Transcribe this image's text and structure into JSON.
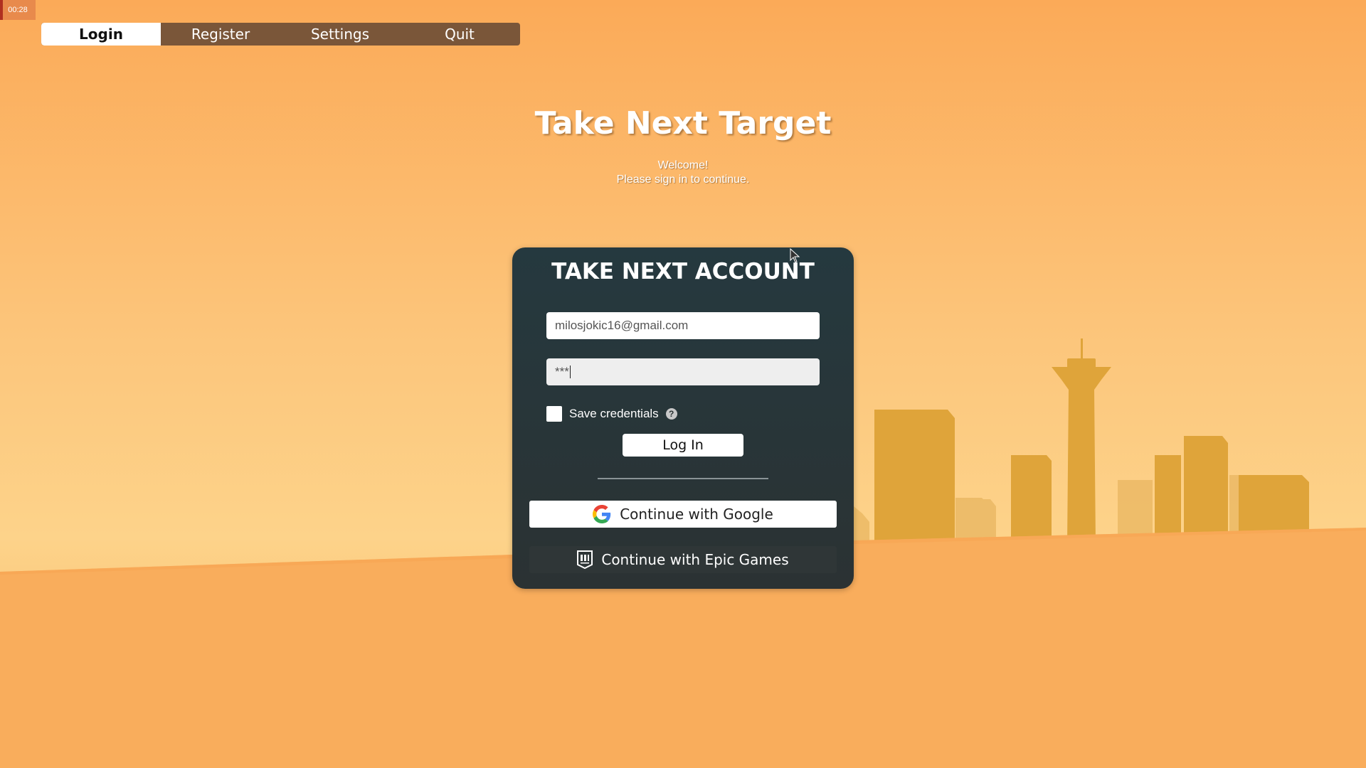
{
  "timer": "00:28",
  "nav": {
    "tabs": [
      {
        "label": "Login",
        "active": true
      },
      {
        "label": "Register",
        "active": false
      },
      {
        "label": "Settings",
        "active": false
      },
      {
        "label": "Quit",
        "active": false
      }
    ]
  },
  "header": {
    "title": "Take Next Target",
    "welcome": "Welcome!",
    "prompt": "Please sign in to continue."
  },
  "login_card": {
    "title": "TAKE NEXT ACCOUNT",
    "email_value": "milosjokic16@gmail.com",
    "password_value": "***",
    "save_credentials_label": "Save credentials",
    "save_credentials_checked": false,
    "help_glyph": "?",
    "login_button": "Log In",
    "google_button": "Continue with Google",
    "epic_button": "Continue with Epic Games",
    "icons": [
      "google-icon",
      "epic-games-icon",
      "help-icon"
    ]
  },
  "colors": {
    "sky_top": "#fbaa58",
    "sky_bottom": "#fdd38a",
    "card_bg": "#25393f",
    "nav_bg": "#7a5639",
    "skyline": "#e1a83e"
  }
}
